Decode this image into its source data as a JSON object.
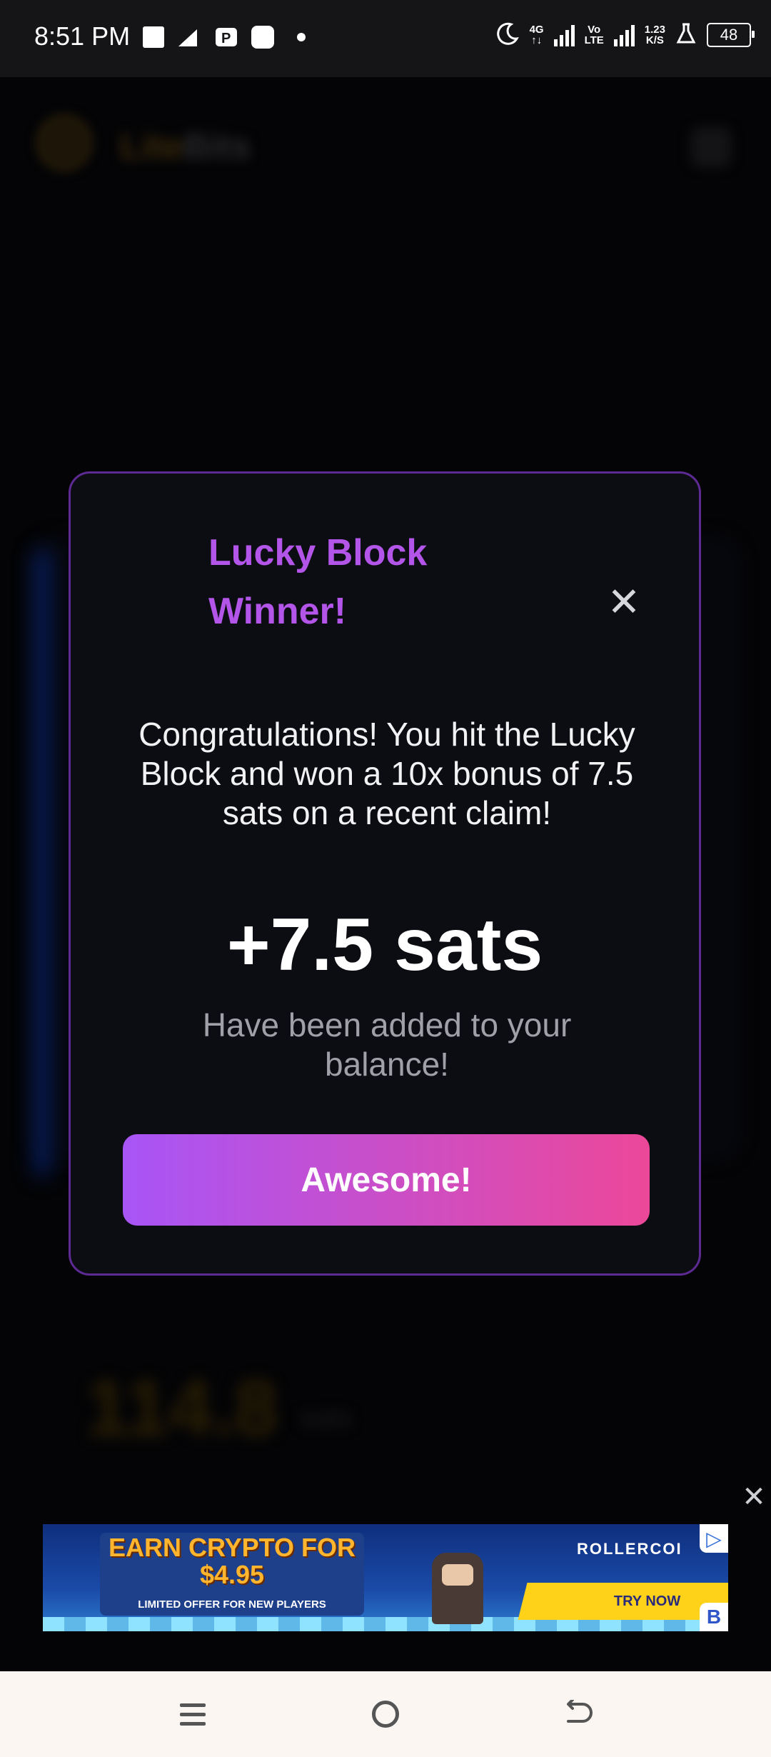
{
  "status_bar": {
    "time": "8:51 PM",
    "network_top": "4G",
    "network_bottom": "↑↓",
    "volte_top": "Vo",
    "volte_bottom": "LTE",
    "speed_top": "1.23",
    "speed_bottom": "K/S",
    "battery": "48"
  },
  "background_page": {
    "logo_text_a": "Lite",
    "logo_text_b": "Bits",
    "amount": "114.8",
    "amount_unit": "sats"
  },
  "modal": {
    "title": "Lucky Block Winner!",
    "close_icon": "close-icon",
    "message": "Congratulations! You hit the Lucky Block and won a 10x bonus of 7.5 sats on a recent claim!",
    "amount": "+7.5 sats",
    "subtext": "Have been added to your balance!",
    "button_label": "Awesome!",
    "colors": {
      "title": "#b255e8",
      "border": "#5d2a93",
      "button_start": "#a855f7",
      "button_end": "#ec4899"
    }
  },
  "ad": {
    "headline": "EARN CRYPTO FOR $4.95",
    "subline": "LIMITED OFFER FOR NEW PLAYERS",
    "brand": "ROLLERCOI",
    "cta": "TRY NOW",
    "close_label": "✕"
  },
  "nav": {
    "icons": [
      "menu-icon",
      "home-icon",
      "back-icon"
    ]
  }
}
